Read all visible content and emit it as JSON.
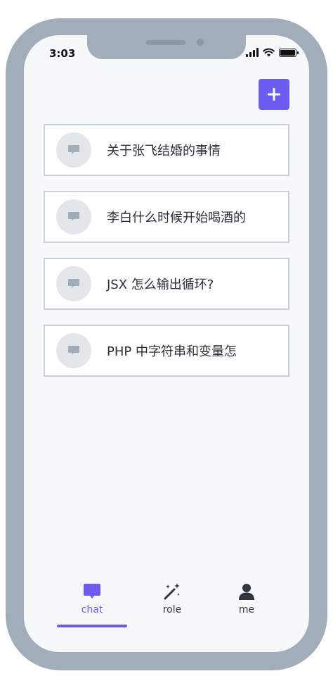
{
  "status_bar": {
    "time": "3:03"
  },
  "header": {
    "add_button_icon": "plus-icon"
  },
  "chats": [
    {
      "title": "关于张飞结婚的事情",
      "icon": "message-icon"
    },
    {
      "title": "李白什么时候开始喝酒的",
      "icon": "message-icon"
    },
    {
      "title": "JSX 怎么输出循环?",
      "icon": "message-icon"
    },
    {
      "title": "PHP 中字符串和变量怎",
      "icon": "message-icon"
    }
  ],
  "tabbar": {
    "tabs": [
      {
        "label": "chat",
        "icon": "chat-bubble-icon",
        "active": true
      },
      {
        "label": "role",
        "icon": "magic-wand-icon",
        "active": false
      },
      {
        "label": "me",
        "icon": "user-icon",
        "active": false
      }
    ]
  },
  "colors": {
    "accent": "#6b5bf0",
    "frame": "#a1aeba",
    "screen_bg": "#f7f8fa",
    "card_border": "#c5d0d8"
  }
}
